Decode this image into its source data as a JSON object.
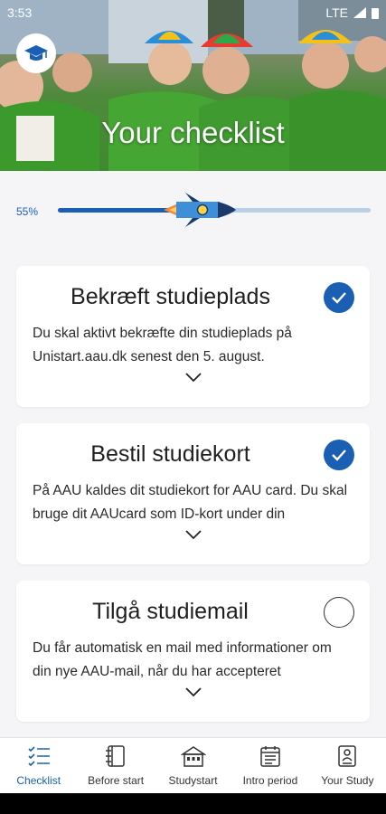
{
  "status_bar": {
    "time": "3:53",
    "network": "LTE"
  },
  "header": {
    "title": "Your checklist",
    "logo_icon": "graduation-cap-icon"
  },
  "progress": {
    "label": "55%",
    "value": 0.55
  },
  "cards": [
    {
      "title": "Bekræft studieplads",
      "body": "Du skal aktivt bekræfte din studieplads på Unistart.aau.dk senest den 5. august.",
      "checked": true
    },
    {
      "title": "Bestil studiekort",
      "body": "På AAU kaldes dit studiekort for AAU card. Du skal bruge dit AAUcard som ID-kort under din",
      "checked": true
    },
    {
      "title": "Tilgå studiemail",
      "body": "Du får automatisk en mail med informationer om din nye AAU-mail, når du har accepteret",
      "checked": false
    }
  ],
  "nav": [
    {
      "label": "Checklist",
      "icon": "checklist-icon",
      "active": true
    },
    {
      "label": "Before start",
      "icon": "notebook-icon",
      "active": false
    },
    {
      "label": "Studystart",
      "icon": "building-icon",
      "active": false
    },
    {
      "label": "Intro period",
      "icon": "calendar-icon",
      "active": false
    },
    {
      "label": "Your Study",
      "icon": "id-card-icon",
      "active": false
    }
  ],
  "colors": {
    "accent": "#1a5fb4",
    "track": "#b9cfe6"
  }
}
